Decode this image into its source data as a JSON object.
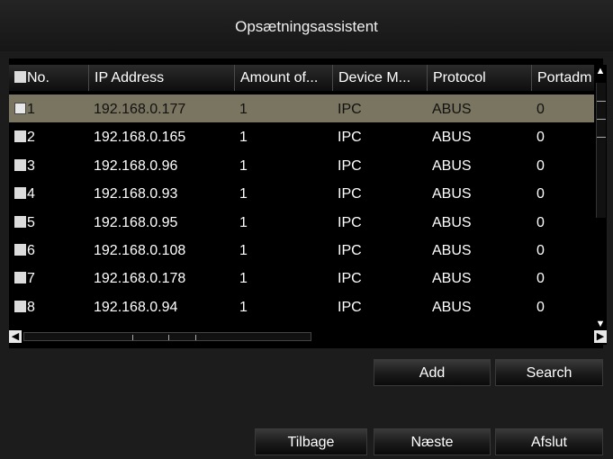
{
  "window": {
    "title": "Opsætningsassistent"
  },
  "table": {
    "columns": [
      "No.",
      "IP Address",
      "Amount of...",
      "Device M...",
      "Protocol",
      "Portadm"
    ],
    "rows": [
      {
        "no": "1",
        "ip": "192.168.0.177",
        "amount": "1",
        "model": "IPC",
        "protocol": "ABUS",
        "port": "0"
      },
      {
        "no": "2",
        "ip": "192.168.0.165",
        "amount": "1",
        "model": "IPC",
        "protocol": "ABUS",
        "port": "0"
      },
      {
        "no": "3",
        "ip": "192.168.0.96",
        "amount": "1",
        "model": "IPC",
        "protocol": "ABUS",
        "port": "0"
      },
      {
        "no": "4",
        "ip": "192.168.0.93",
        "amount": "1",
        "model": "IPC",
        "protocol": "ABUS",
        "port": "0"
      },
      {
        "no": "5",
        "ip": "192.168.0.95",
        "amount": "1",
        "model": "IPC",
        "protocol": "ABUS",
        "port": "0"
      },
      {
        "no": "6",
        "ip": "192.168.0.108",
        "amount": "1",
        "model": "IPC",
        "protocol": "ABUS",
        "port": "0"
      },
      {
        "no": "7",
        "ip": "192.168.0.178",
        "amount": "1",
        "model": "IPC",
        "protocol": "ABUS",
        "port": "0"
      },
      {
        "no": "8",
        "ip": "192.168.0.94",
        "amount": "1",
        "model": "IPC",
        "protocol": "ABUS",
        "port": "0"
      }
    ],
    "selected_row": "1"
  },
  "actions": {
    "add": "Add",
    "search": "Search"
  },
  "nav": {
    "back": "Tilbage",
    "next": "Næste",
    "finish": "Afslut"
  },
  "icons": {
    "scroll_up": "scroll-up-icon",
    "scroll_down": "scroll-down-icon",
    "scroll_left": "scroll-left-icon",
    "scroll_right": "scroll-right-icon"
  },
  "colors": {
    "selected_row": "#7a7560",
    "background": "#1c1c1c",
    "table_bg": "#000000"
  }
}
